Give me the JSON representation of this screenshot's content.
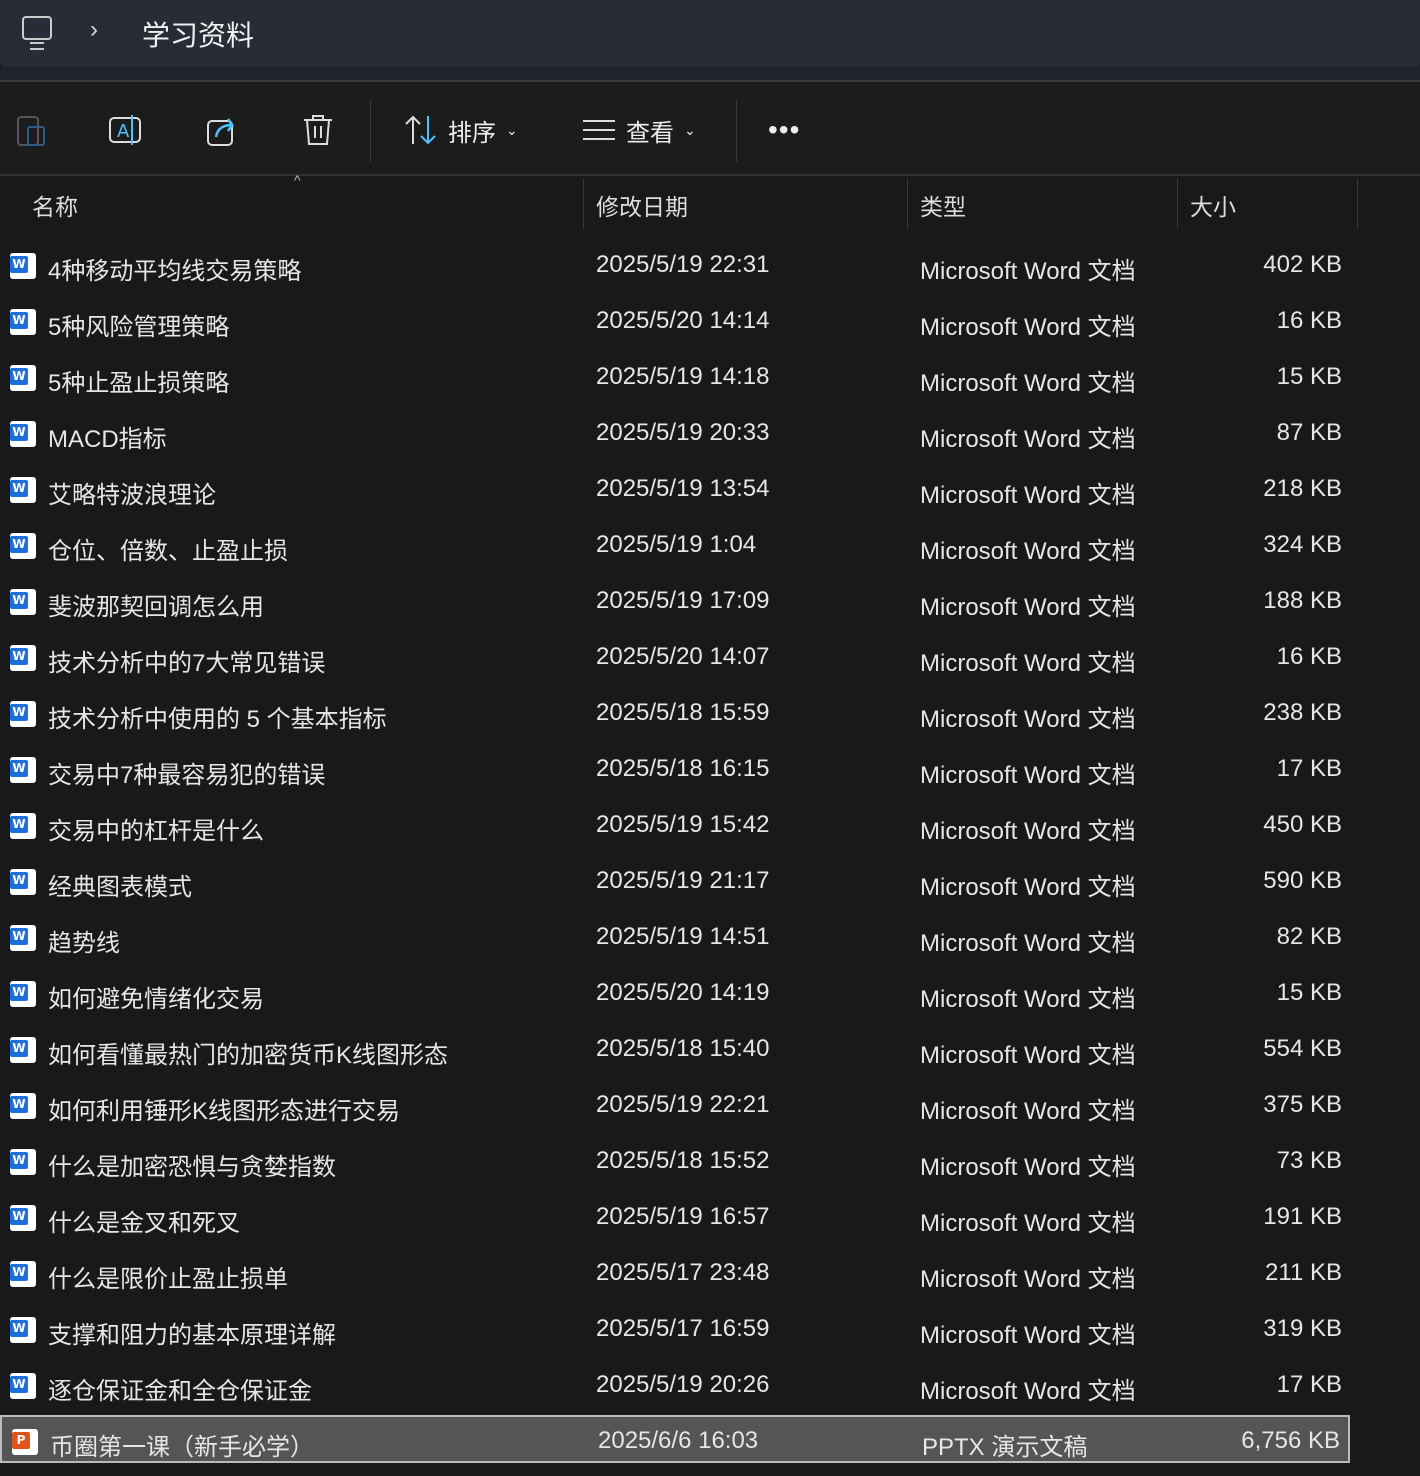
{
  "breadcrumb": {
    "current": "学习资料"
  },
  "toolbar": {
    "sort_label": "排序",
    "view_label": "查看"
  },
  "columns": {
    "name": "名称",
    "date": "修改日期",
    "type": "类型",
    "size": "大小"
  },
  "files": [
    {
      "name": "4种移动平均线交易策略",
      "date": "2025/5/19 22:31",
      "type": "Microsoft Word 文档",
      "size": "402 KB",
      "icon": "word"
    },
    {
      "name": "5种风险管理策略",
      "date": "2025/5/20 14:14",
      "type": "Microsoft Word 文档",
      "size": "16 KB",
      "icon": "word"
    },
    {
      "name": "5种止盈止损策略",
      "date": "2025/5/19 14:18",
      "type": "Microsoft Word 文档",
      "size": "15 KB",
      "icon": "word"
    },
    {
      "name": "MACD指标",
      "date": "2025/5/19 20:33",
      "type": "Microsoft Word 文档",
      "size": "87 KB",
      "icon": "word"
    },
    {
      "name": "艾略特波浪理论",
      "date": "2025/5/19 13:54",
      "type": "Microsoft Word 文档",
      "size": "218 KB",
      "icon": "word"
    },
    {
      "name": "仓位、倍数、止盈止损",
      "date": "2025/5/19 1:04",
      "type": "Microsoft Word 文档",
      "size": "324 KB",
      "icon": "word"
    },
    {
      "name": "斐波那契回调怎么用",
      "date": "2025/5/19 17:09",
      "type": "Microsoft Word 文档",
      "size": "188 KB",
      "icon": "word"
    },
    {
      "name": "技术分析中的7大常见错误",
      "date": "2025/5/20 14:07",
      "type": "Microsoft Word 文档",
      "size": "16 KB",
      "icon": "word"
    },
    {
      "name": "技术分析中使用的 5 个基本指标",
      "date": "2025/5/18 15:59",
      "type": "Microsoft Word 文档",
      "size": "238 KB",
      "icon": "word"
    },
    {
      "name": "交易中7种最容易犯的错误",
      "date": "2025/5/18 16:15",
      "type": "Microsoft Word 文档",
      "size": "17 KB",
      "icon": "word"
    },
    {
      "name": "交易中的杠杆是什么",
      "date": "2025/5/19 15:42",
      "type": "Microsoft Word 文档",
      "size": "450 KB",
      "icon": "word"
    },
    {
      "name": "经典图表模式",
      "date": "2025/5/19 21:17",
      "type": "Microsoft Word 文档",
      "size": "590 KB",
      "icon": "word"
    },
    {
      "name": "趋势线",
      "date": "2025/5/19 14:51",
      "type": "Microsoft Word 文档",
      "size": "82 KB",
      "icon": "word"
    },
    {
      "name": "如何避免情绪化交易",
      "date": "2025/5/20 14:19",
      "type": "Microsoft Word 文档",
      "size": "15 KB",
      "icon": "word"
    },
    {
      "name": "如何看懂最热门的加密货币K线图形态",
      "date": "2025/5/18 15:40",
      "type": "Microsoft Word 文档",
      "size": "554 KB",
      "icon": "word"
    },
    {
      "name": "如何利用锤形K线图形态进行交易",
      "date": "2025/5/19 22:21",
      "type": "Microsoft Word 文档",
      "size": "375 KB",
      "icon": "word"
    },
    {
      "name": "什么是加密恐惧与贪婪指数",
      "date": "2025/5/18 15:52",
      "type": "Microsoft Word 文档",
      "size": "73 KB",
      "icon": "word"
    },
    {
      "name": "什么是金叉和死叉",
      "date": "2025/5/19 16:57",
      "type": "Microsoft Word 文档",
      "size": "191 KB",
      "icon": "word"
    },
    {
      "name": "什么是限价止盈止损单",
      "date": "2025/5/17 23:48",
      "type": "Microsoft Word 文档",
      "size": "211 KB",
      "icon": "word"
    },
    {
      "name": "支撑和阻力的基本原理详解",
      "date": "2025/5/17 16:59",
      "type": "Microsoft Word 文档",
      "size": "319 KB",
      "icon": "word"
    },
    {
      "name": "逐仓保证金和全仓保证金",
      "date": "2025/5/19 20:26",
      "type": "Microsoft Word 文档",
      "size": "17 KB",
      "icon": "word"
    },
    {
      "name": "币圈第一课（新手必学）",
      "date": "2025/6/6 16:03",
      "type": "PPTX 演示文稿",
      "size": "6,756 KB",
      "icon": "powerpoint",
      "selected": true
    }
  ]
}
